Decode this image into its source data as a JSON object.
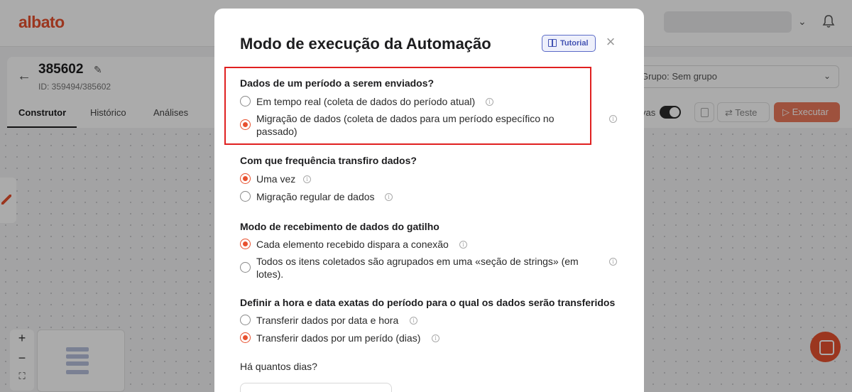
{
  "app": {
    "logo": "albato",
    "automation_title": "385602",
    "automation_id": "ID: 359494/385602",
    "tabs": [
      {
        "label": "Construtor",
        "active": true
      },
      {
        "label": "Histórico",
        "active": false
      },
      {
        "label": "Análises",
        "active": false
      }
    ],
    "group_select": "Grupo: Sem grupo",
    "toggle_label_partial": "vas",
    "test_label": "Teste",
    "execute_label": "Executar",
    "zoom_in": "+",
    "zoom_out": "−",
    "colors": {
      "brand": "#e8512f",
      "accent": "#4353b3"
    }
  },
  "modal": {
    "title": "Modo de execução da Automação",
    "tutorial_label": "Tutorial",
    "close_icon": "×",
    "sections": [
      {
        "question": "Dados de um período a serem enviados?",
        "options": [
          {
            "label": "Em tempo real (coleta de dados do período atual)",
            "selected": false
          },
          {
            "label": "Migração de dados (coleta de dados para um período específico no passado)",
            "selected": true
          }
        ]
      },
      {
        "question": "Com que frequência transfiro dados?",
        "options": [
          {
            "label": "Uma vez",
            "selected": true
          },
          {
            "label": "Migração regular de dados",
            "selected": false
          }
        ]
      },
      {
        "question": "Modo de recebimento de dados do gatilho",
        "options": [
          {
            "label": "Cada elemento recebido dispara a conexão",
            "selected": true
          },
          {
            "label": "Todos os itens coletados são agrupados em uma «seção de strings» (em lotes).",
            "selected": false
          }
        ]
      },
      {
        "question": "Definir a hora e data exatas do período para o qual os dados serão transferidos",
        "options": [
          {
            "label": "Transferir dados por data e hora",
            "selected": false
          },
          {
            "label": "Transferir dados por um perído (dias)",
            "selected": true
          }
        ]
      }
    ],
    "days_label": "Há quantos dias?",
    "days_value": ""
  }
}
